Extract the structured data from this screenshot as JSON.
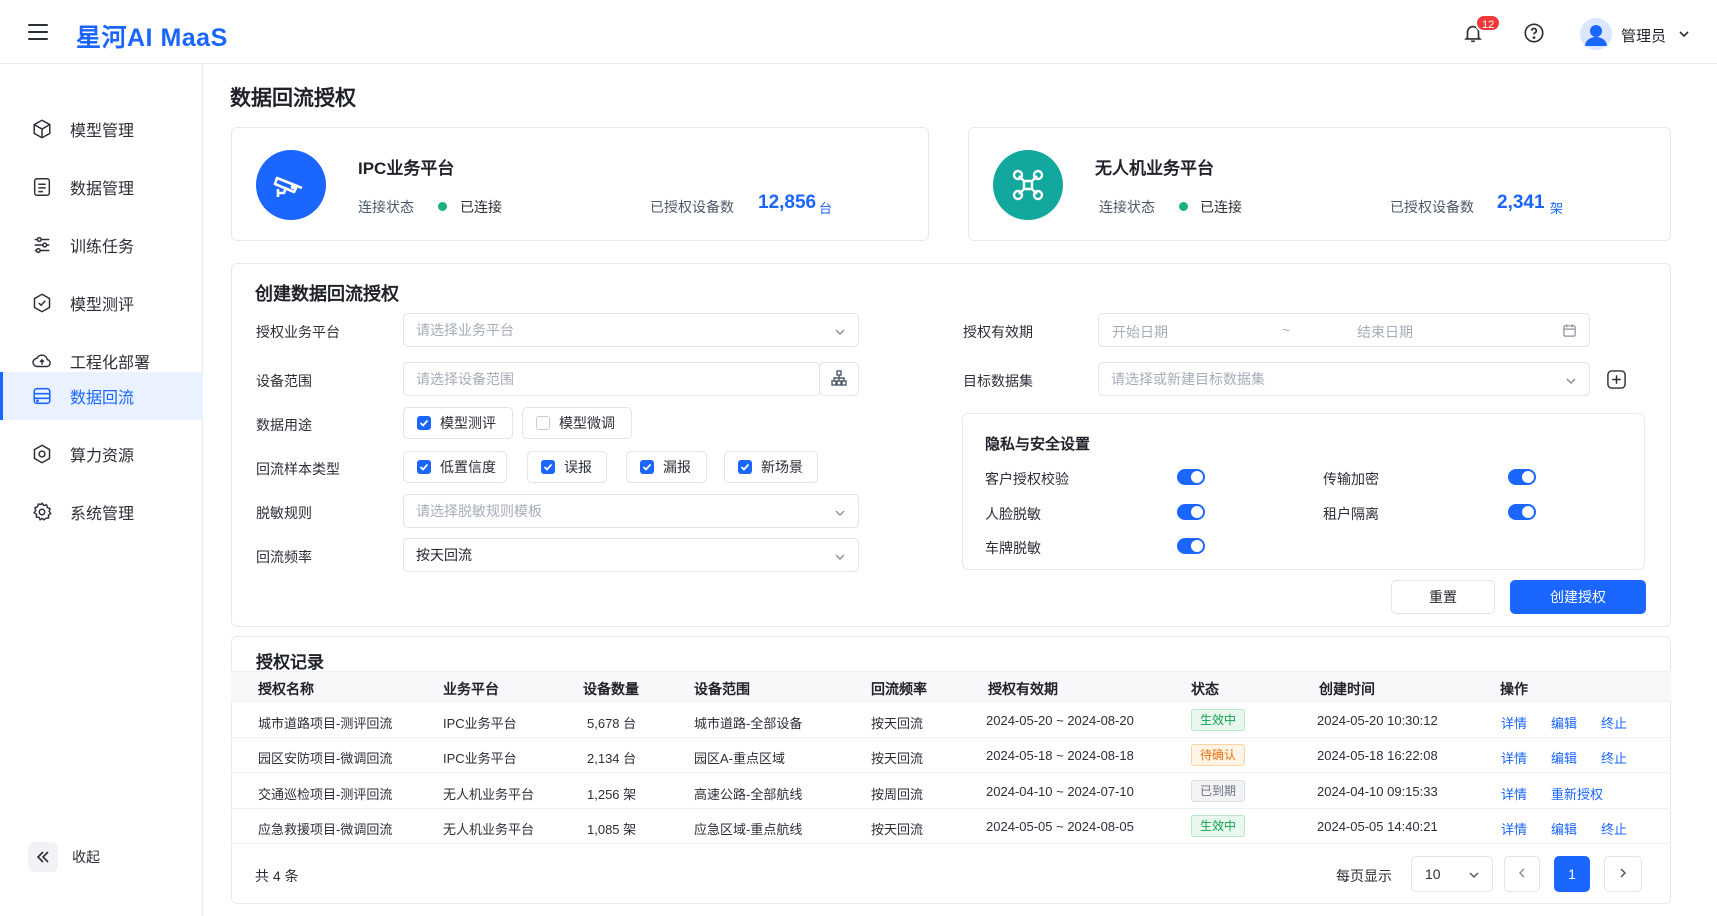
{
  "app": {
    "title": "星河AI MaaS",
    "notifications": "12",
    "user": "管理员"
  },
  "sidebar": {
    "items": [
      {
        "label": "模型管理",
        "icon": "cube-icon"
      },
      {
        "label": "数据管理",
        "icon": "document-icon"
      },
      {
        "label": "训练任务",
        "icon": "sliders-icon"
      },
      {
        "label": "模型测评",
        "icon": "badge-check-icon"
      },
      {
        "label": "工程化部署",
        "icon": "cloud-upload-icon"
      },
      {
        "label": "数据回流",
        "icon": "database-icon"
      },
      {
        "label": "算力资源",
        "icon": "hexagon-icon"
      },
      {
        "label": "系统管理",
        "icon": "gear-icon"
      }
    ],
    "active_index": 5,
    "collapse_label": "收起"
  },
  "page": {
    "title": "数据回流授权"
  },
  "platforms": [
    {
      "name": "IPC业务平台",
      "status_label": "连接状态",
      "status": "已连接",
      "devices_label": "已授权设备数",
      "devices": "12,856",
      "unit": "台",
      "color": "#1a66ff",
      "icon": "camera-icon"
    },
    {
      "name": "无人机业务平台",
      "status_label": "连接状态",
      "status": "已连接",
      "devices_label": "已授权设备数",
      "devices": "2,341",
      "unit": "架",
      "color": "#13a89e",
      "icon": "drone-icon"
    }
  ],
  "form": {
    "title": "创建数据回流授权",
    "platform_label": "授权业务平台",
    "platform_placeholder": "请选择业务平台",
    "range_label": "设备范围",
    "range_placeholder": "请选择设备范围",
    "usage_label": "数据用途",
    "usage_options": [
      {
        "label": "模型测评",
        "checked": true
      },
      {
        "label": "模型微调",
        "checked": false
      }
    ],
    "sample_label": "回流样本类型",
    "sample_options": [
      {
        "label": "低置信度",
        "checked": true
      },
      {
        "label": "误报",
        "checked": true
      },
      {
        "label": "漏报",
        "checked": true
      },
      {
        "label": "新场景",
        "checked": true
      }
    ],
    "mask_label": "脱敏规则",
    "mask_placeholder": "请选择脱敏规则模板",
    "freq_label": "回流频率",
    "freq_value": "按天回流",
    "validity_label": "授权有效期",
    "start_placeholder": "开始日期",
    "range_sep": "~",
    "end_placeholder": "结束日期",
    "dataset_label": "目标数据集",
    "dataset_placeholder": "请选择或新建目标数据集",
    "privacy": {
      "title": "隐私与安全设置",
      "items": [
        {
          "label": "客户授权校验",
          "on": true
        },
        {
          "label": "传输加密",
          "on": true
        },
        {
          "label": "人脸脱敏",
          "on": true
        },
        {
          "label": "租户隔离",
          "on": true
        },
        {
          "label": "车牌脱敏",
          "on": true
        }
      ]
    },
    "reset_label": "重置",
    "submit_label": "创建授权"
  },
  "records": {
    "title": "授权记录",
    "columns": [
      "授权名称",
      "业务平台",
      "设备数量",
      "设备范围",
      "回流频率",
      "授权有效期",
      "状态",
      "创建时间",
      "操作"
    ],
    "rows": [
      {
        "name": "城市道路项目-测评回流",
        "platform": "IPC业务平台",
        "count": "5,678 台",
        "range": "城市道路-全部设备",
        "freq": "按天回流",
        "validity": "2024-05-20 ~ 2024-08-20",
        "status": "生效中",
        "status_kind": "active",
        "created": "2024-05-20 10:30:12",
        "actions": [
          "详情",
          "编辑",
          "终止"
        ]
      },
      {
        "name": "园区安防项目-微调回流",
        "platform": "IPC业务平台",
        "count": "2,134 台",
        "range": "园区A-重点区域",
        "freq": "按天回流",
        "validity": "2024-05-18 ~ 2024-08-18",
        "status": "待确认",
        "status_kind": "pending",
        "created": "2024-05-18 16:22:08",
        "actions": [
          "详情",
          "编辑",
          "终止"
        ]
      },
      {
        "name": "交通巡检项目-测评回流",
        "platform": "无人机业务平台",
        "count": "1,256 架",
        "range": "高速公路-全部航线",
        "freq": "按周回流",
        "validity": "2024-04-10 ~ 2024-07-10",
        "status": "已到期",
        "status_kind": "expired",
        "created": "2024-04-10 09:15:33",
        "actions": [
          "详情",
          "重新授权"
        ]
      },
      {
        "name": "应急救援项目-微调回流",
        "platform": "无人机业务平台",
        "count": "1,085 架",
        "range": "应急区域-重点航线",
        "freq": "按天回流",
        "validity": "2024-05-05 ~ 2024-08-05",
        "status": "生效中",
        "status_kind": "active",
        "created": "2024-05-05 14:40:21",
        "actions": [
          "详情",
          "编辑",
          "终止"
        ]
      }
    ],
    "total": "共 4 条",
    "page_size_label": "每页显示",
    "page_size": "10",
    "current_page": "1"
  }
}
